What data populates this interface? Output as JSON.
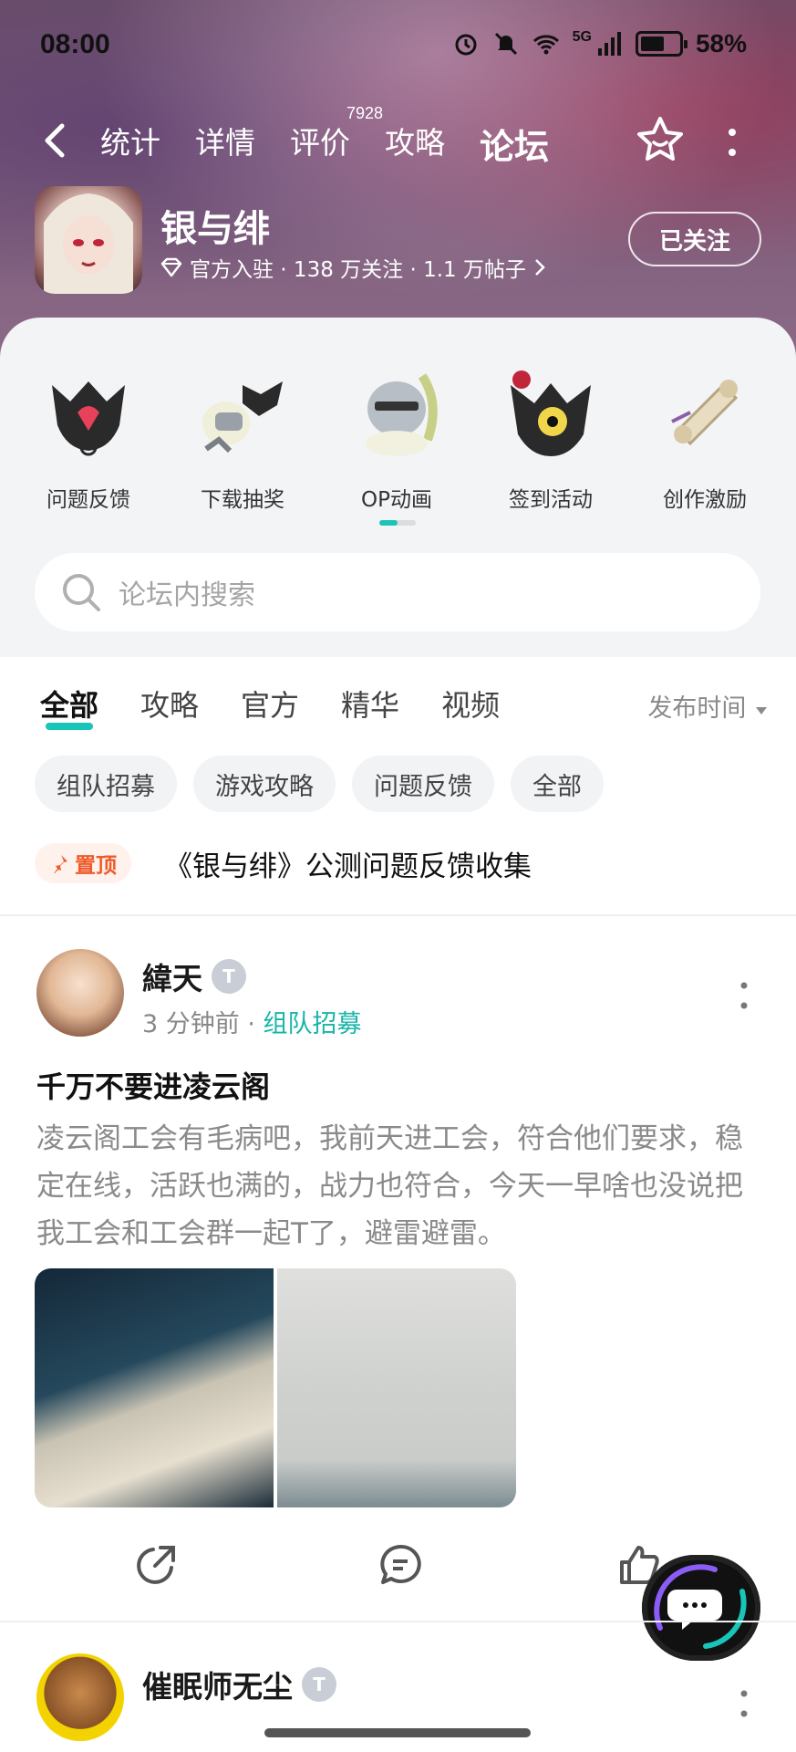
{
  "status_bar": {
    "time": "08:00",
    "network": "5G",
    "battery": "58%"
  },
  "nav": {
    "tabs": [
      {
        "label": "统计"
      },
      {
        "label": "详情"
      },
      {
        "label": "评价",
        "badge": "7928"
      },
      {
        "label": "攻略"
      },
      {
        "label": "论坛"
      }
    ],
    "active_tab": "论坛"
  },
  "game": {
    "title": "银与绯",
    "meta": "官方入驻 · 138 万关注 · 1.1 万帖子",
    "follow_label": "已关注"
  },
  "categories": [
    {
      "label": "问题反馈"
    },
    {
      "label": "下载抽奖"
    },
    {
      "label": "OP动画"
    },
    {
      "label": "签到活动"
    },
    {
      "label": "创作激励"
    }
  ],
  "search": {
    "placeholder": "论坛内搜索"
  },
  "filter_tabs": [
    {
      "label": "全部"
    },
    {
      "label": "攻略"
    },
    {
      "label": "官方"
    },
    {
      "label": "精华"
    },
    {
      "label": "视频"
    }
  ],
  "sort_label": "发布时间",
  "chips": [
    {
      "label": "组队招募"
    },
    {
      "label": "游戏攻略"
    },
    {
      "label": "问题反馈"
    },
    {
      "label": "全部"
    }
  ],
  "pinned": {
    "badge": "置顶",
    "title": "《银与绯》公测问题反馈收集"
  },
  "post": {
    "author": "緯天",
    "level": "T",
    "time": "3 分钟前",
    "tag": "组队招募",
    "title": "千万不要进凌云阁",
    "body": "凌云阁工会有毛病吧，我前天进工会，符合他们要求，稳定在线，活跃也满的，战力也符合，今天一早啥也没说把我工会和工会群一起T了，避雷避雷。"
  },
  "post2": {
    "author": "催眠师无尘",
    "level": "T"
  },
  "colors": {
    "accent": "#19c5b8",
    "pin": "#ef5b2b"
  }
}
